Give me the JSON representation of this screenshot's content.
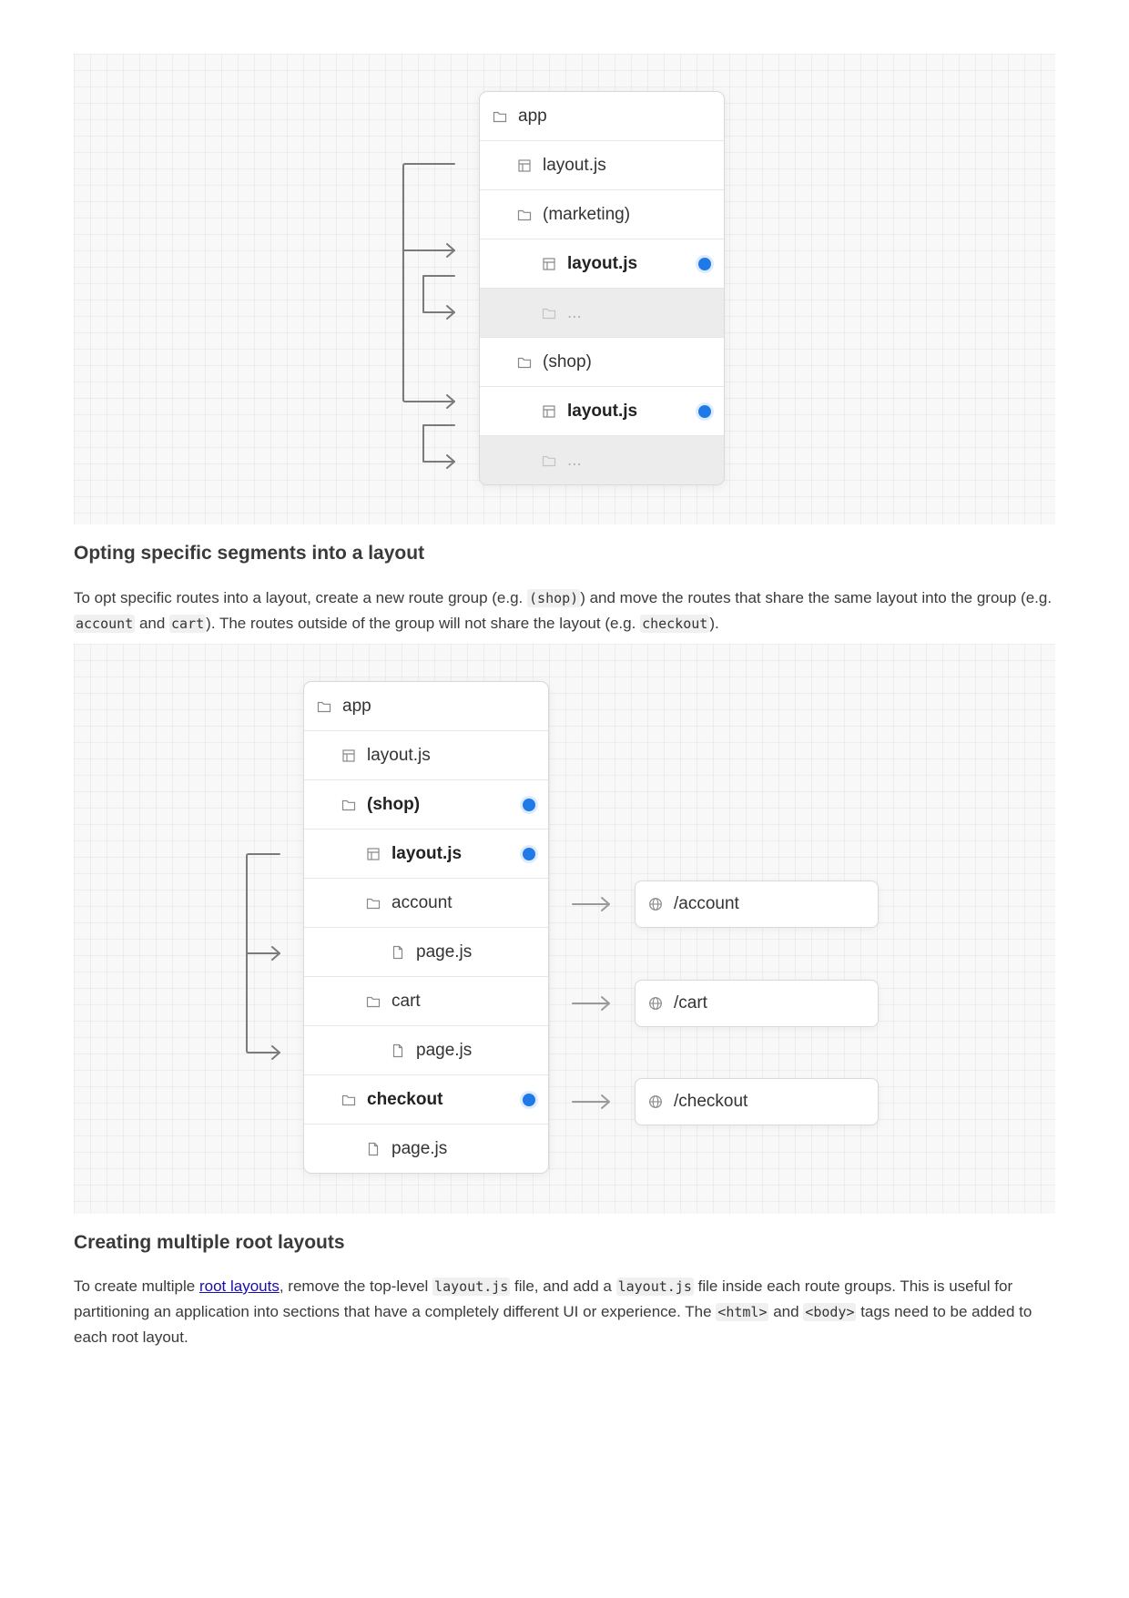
{
  "figure1": {
    "rows": [
      {
        "label": "app",
        "icon": "folder-icon"
      },
      {
        "label": "layout.js",
        "icon": "layout-file-icon"
      },
      {
        "label": "(marketing)",
        "icon": "folder-icon"
      },
      {
        "label": "layout.js",
        "icon": "layout-file-icon"
      },
      {
        "label": "...",
        "icon": "folder-icon"
      },
      {
        "label": "(shop)",
        "icon": "folder-icon"
      },
      {
        "label": "layout.js",
        "icon": "layout-file-icon"
      },
      {
        "label": "...",
        "icon": "folder-icon"
      }
    ],
    "accent_color": "#1f7ae8"
  },
  "section1": {
    "heading": "Opting specific segments into a layout",
    "para": {
      "t1": "To opt specific routes into a layout, create a new route group (e.g. ",
      "c1": "(shop)",
      "t2": ") and move the routes that share the same layout into the group (e.g. ",
      "c2": "account",
      "t3": " and ",
      "c3": "cart",
      "t4": "). The routes outside of the group will not share the layout (e.g. ",
      "c4": "checkout",
      "t5": ")."
    }
  },
  "figure2": {
    "rows": [
      {
        "label": "app",
        "icon": "folder-icon"
      },
      {
        "label": "layout.js",
        "icon": "layout-file-icon"
      },
      {
        "label": "(shop)",
        "icon": "folder-icon"
      },
      {
        "label": "layout.js",
        "icon": "layout-file-icon"
      },
      {
        "label": "account",
        "icon": "folder-icon"
      },
      {
        "label": "page.js",
        "icon": "page-file-icon"
      },
      {
        "label": "cart",
        "icon": "folder-icon"
      },
      {
        "label": "page.js",
        "icon": "page-file-icon"
      },
      {
        "label": "checkout",
        "icon": "folder-icon"
      },
      {
        "label": "page.js",
        "icon": "page-file-icon"
      }
    ],
    "routes": [
      "/account",
      "/cart",
      "/checkout"
    ]
  },
  "section2": {
    "heading": "Creating multiple root layouts",
    "para": {
      "t1": "To create multiple ",
      "link": "root layouts",
      "t2": ", remove the top-level ",
      "c1": "layout.js",
      "t3": " file, and add a ",
      "c2": "layout.js",
      "t4": " file inside each route groups. This is useful for partitioning an application into sections that have a completely different UI or experience. The ",
      "c3": "<html>",
      "t5": " and ",
      "c4": "<body>",
      "t6": " tags need to be added to each root layout."
    }
  }
}
